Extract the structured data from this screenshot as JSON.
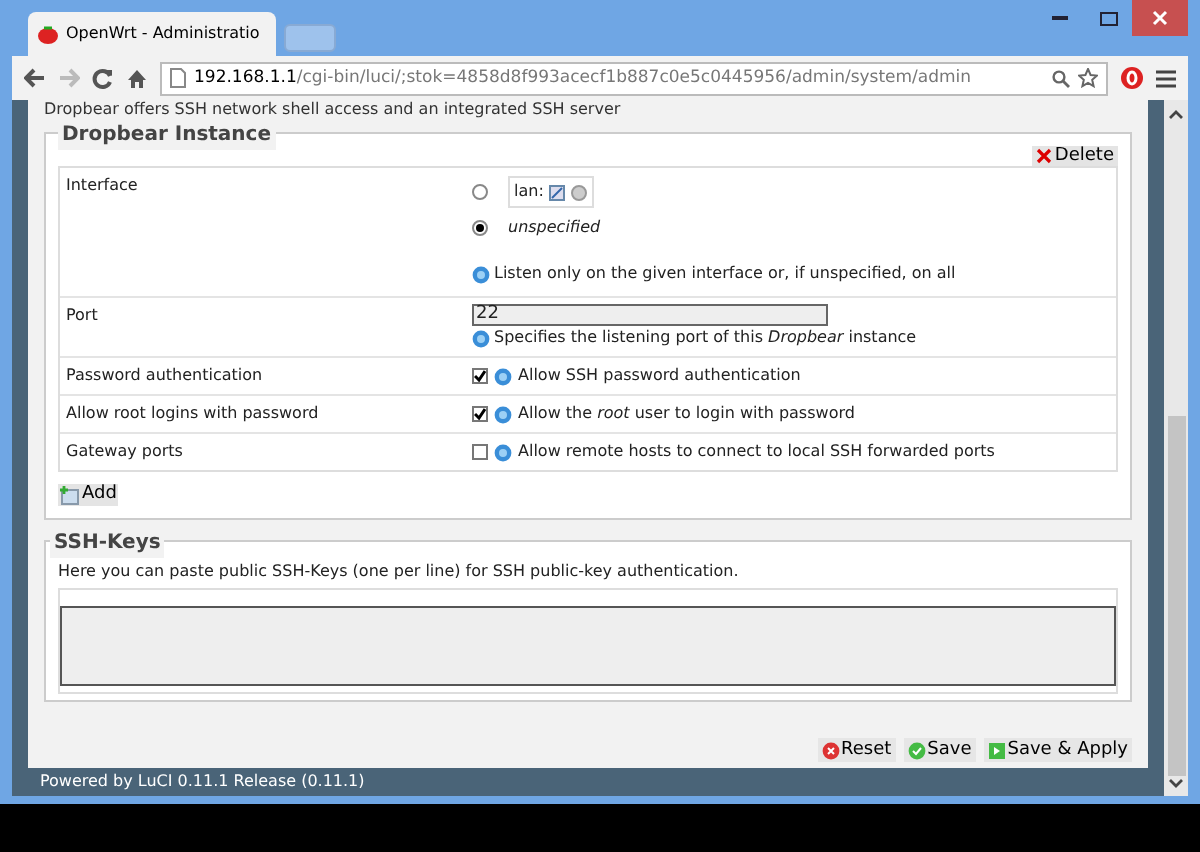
{
  "browser": {
    "tab_title": "OpenWrt - Administratio",
    "address_host": "192.168.1.1",
    "address_path": "/cgi-bin/luci/;stok=4858d8f993acecf1b887c0e5c0445956/admin/system/admin"
  },
  "intro": "Dropbear offers SSH network shell access and an integrated SSH server",
  "dropbear": {
    "legend": "Dropbear Instance",
    "delete_label": "Delete",
    "add_label": "Add",
    "rows": [
      {
        "kind": "radio_group",
        "label": "Interface",
        "options": [
          {
            "label": "lan:",
            "selected": false,
            "kind": "network"
          },
          {
            "label": "unspecified",
            "selected": true,
            "kind": "plain"
          }
        ],
        "hint": "Listen only on the given interface or, if unspecified, on all"
      },
      {
        "kind": "text_field",
        "label": "Port",
        "value": "22",
        "hint": "Specifies the listening port of this *Dropbear* instance"
      },
      {
        "kind": "checkbox",
        "label": "Password authentication",
        "checked": true,
        "hint": "Allow SSH password authentication"
      },
      {
        "kind": "checkbox",
        "label": "Allow root logins with password",
        "checked": true,
        "hint": "Allow the *root* user to login with password"
      },
      {
        "kind": "checkbox",
        "label": "Gateway ports",
        "checked": false,
        "hint": "Allow remote hosts to connect to local SSH forwarded ports"
      }
    ]
  },
  "ssh_keys": {
    "legend": "SSH-Keys",
    "description": "Here you can paste public SSH-Keys (one per line) for SSH public-key authentication."
  },
  "actions": [
    {
      "kind": "reset",
      "label": "Reset"
    },
    {
      "kind": "save",
      "label": "Save"
    },
    {
      "kind": "apply",
      "label": "Save & Apply"
    }
  ],
  "footer": "Powered by LuCI 0.11.1 Release (0.11.1)"
}
